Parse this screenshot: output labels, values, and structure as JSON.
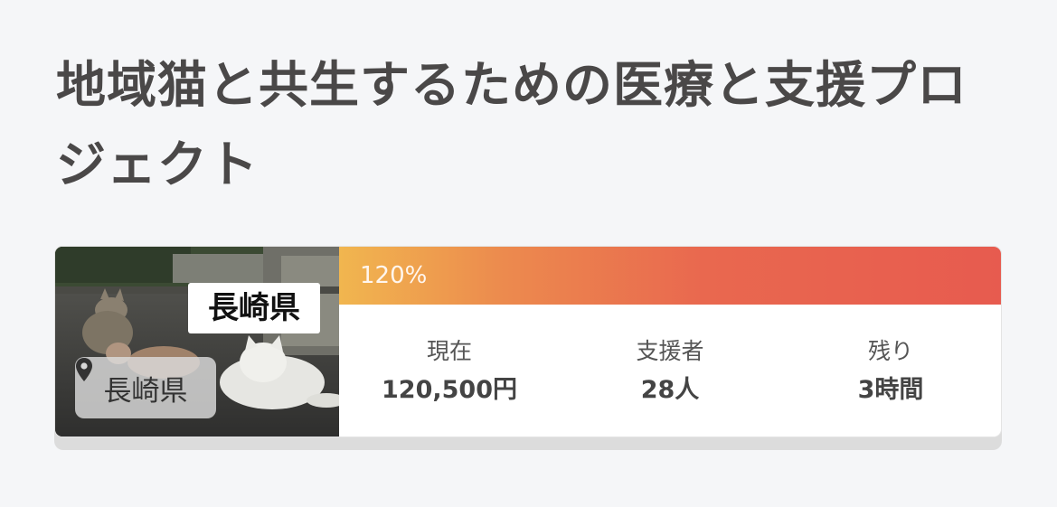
{
  "project": {
    "title": "地域猫と共生するための医療と支援プロジェクト"
  },
  "card": {
    "image_caption": "長崎県",
    "location": "長崎県",
    "progress_label": "120%",
    "progress_percent": 120,
    "stats": [
      {
        "label": "現在",
        "value": "120,500円"
      },
      {
        "label": "支援者",
        "value": "28人"
      },
      {
        "label": "残り",
        "value": "3時間"
      }
    ]
  },
  "colors": {
    "progress_start": "#f1b64f",
    "progress_end": "#e75b4f",
    "background": "#f5f6f8",
    "title_text": "#4a4848"
  },
  "icons": {
    "location": "map-pin-icon"
  }
}
